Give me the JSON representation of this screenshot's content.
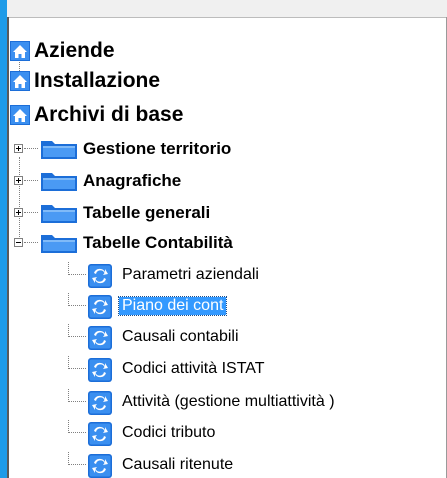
{
  "tree": {
    "roots": [
      {
        "label": "Aziende",
        "icon": "home-folder-icon"
      },
      {
        "label": "Installazione",
        "icon": "home-folder-icon"
      },
      {
        "label": "Archivi di base",
        "icon": "home-folder-icon"
      }
    ],
    "groups": [
      {
        "label": "Gestione territorio",
        "expanded": false,
        "expander": "+"
      },
      {
        "label": "Anagrafiche",
        "expanded": false,
        "expander": "+"
      },
      {
        "label": "Tabelle generali",
        "expanded": false,
        "expander": "+"
      },
      {
        "label": "Tabelle Contabilità",
        "expanded": true,
        "expander": "−"
      }
    ],
    "items": [
      {
        "label": "Parametri aziendali",
        "selected": false,
        "icon": "program-icon"
      },
      {
        "label": "Piano dei cont",
        "selected": true,
        "icon": "program-icon"
      },
      {
        "label": "Causali contabili",
        "selected": false,
        "icon": "program-icon"
      },
      {
        "label": "Codici attività  ISTAT",
        "selected": false,
        "icon": "program-icon"
      },
      {
        "label": "Attività  (gestione multiattività )",
        "selected": false,
        "icon": "program-icon"
      },
      {
        "label": "Codici tributo",
        "selected": false,
        "icon": "program-icon"
      },
      {
        "label": "Causali ritenute",
        "selected": false,
        "icon": "program-icon"
      }
    ]
  },
  "colors": {
    "window_border": "#1e9be8",
    "selection": "#3399ff",
    "folder_blue": "#1c6ed8"
  }
}
